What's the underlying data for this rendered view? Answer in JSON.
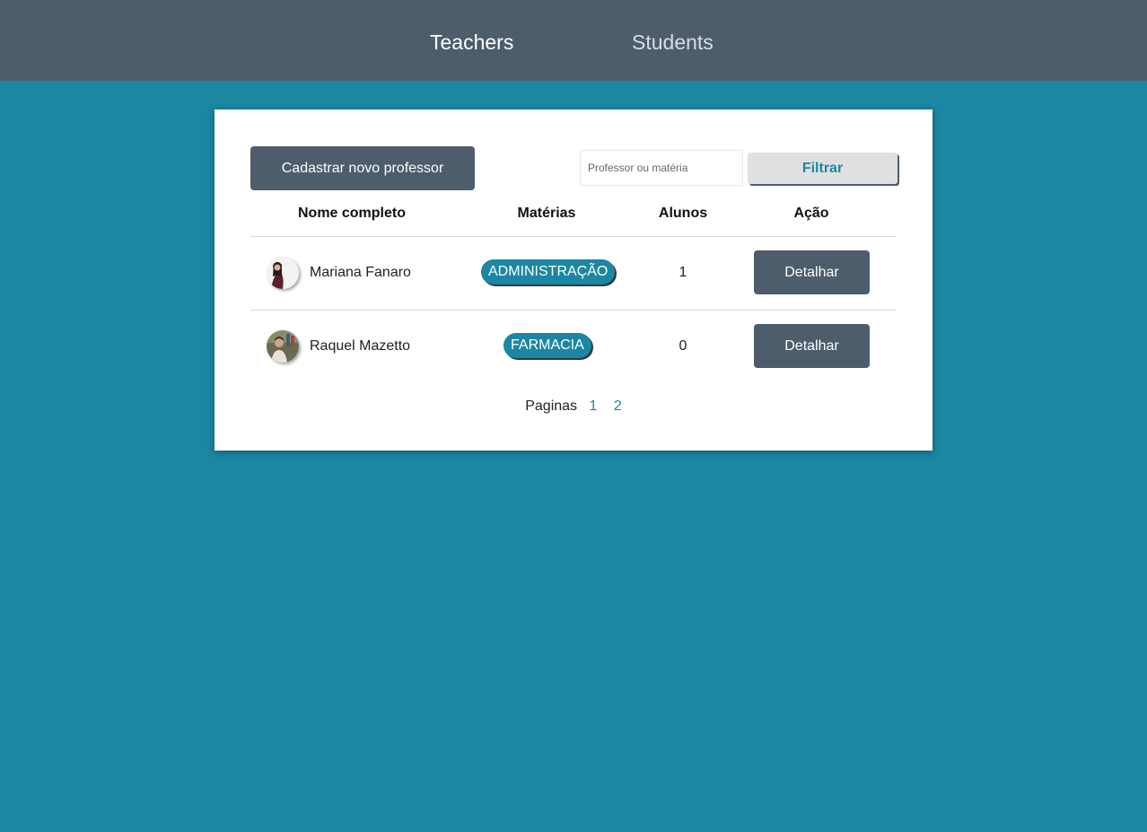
{
  "nav": {
    "teachers_label": "Teachers",
    "students_label": "Students"
  },
  "toolbar": {
    "new_teacher_label": "Cadastrar novo professor",
    "filter_placeholder": "Professor ou matéria",
    "filter_value": "",
    "filter_button_label": "Filtrar"
  },
  "table": {
    "columns": [
      "Nome completo",
      "Matérias",
      "Alunos",
      "Ação"
    ],
    "rows": [
      {
        "name": "Mariana Fanaro",
        "subject": "ADMINISTRAÇÃO",
        "students": "1",
        "action": "Detalhar"
      },
      {
        "name": "Raquel Mazetto",
        "subject": "FARMACIA",
        "students": "0",
        "action": "Detalhar"
      }
    ]
  },
  "pagination": {
    "label": "Paginas",
    "pages": [
      "1",
      "2"
    ]
  },
  "colors": {
    "background": "#1b87a3",
    "navbar": "#4d5d6b",
    "accent": "#1b87a3",
    "button": "#4d5d6b"
  }
}
